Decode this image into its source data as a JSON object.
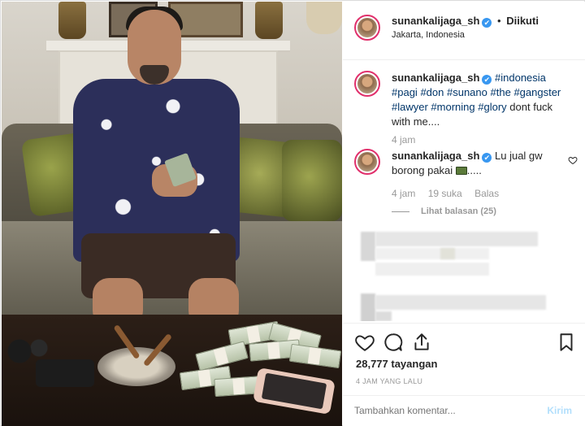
{
  "header": {
    "username": "sunankalijaga_sh",
    "separator": "•",
    "follow_status": "Diikuti",
    "location": "Jakarta, Indonesia",
    "verified_icon": "✔"
  },
  "caption": {
    "username": "sunankalijaga_sh",
    "hashtags": [
      "#indonesia",
      "#pagi",
      "#don",
      "#sunano",
      "#the",
      "#gangster",
      "#lawyer",
      "#morning",
      "#glory"
    ],
    "text_tail": "dont fuck with me....",
    "time": "4 jam"
  },
  "comment": {
    "username": "sunankalijaga_sh",
    "text": "Lu jual gw borong pakai",
    "emoji": "money-bill-emoji",
    "text_after_emoji": ".....",
    "time": "4 jam",
    "likes": "19 suka",
    "reply_label": "Balas",
    "view_replies": "Lihat balasan (25)"
  },
  "actions": {
    "views": "28,777 tayangan",
    "timestamp": "4 JAM YANG LALU"
  },
  "add_comment": {
    "placeholder": "Tambahkan komentar...",
    "post_label": "Kirim"
  },
  "colors": {
    "link": "#003569",
    "verified": "#3897f0",
    "ring": "#e1306c",
    "muted": "#999999",
    "post_disabled": "#b2dffc"
  }
}
